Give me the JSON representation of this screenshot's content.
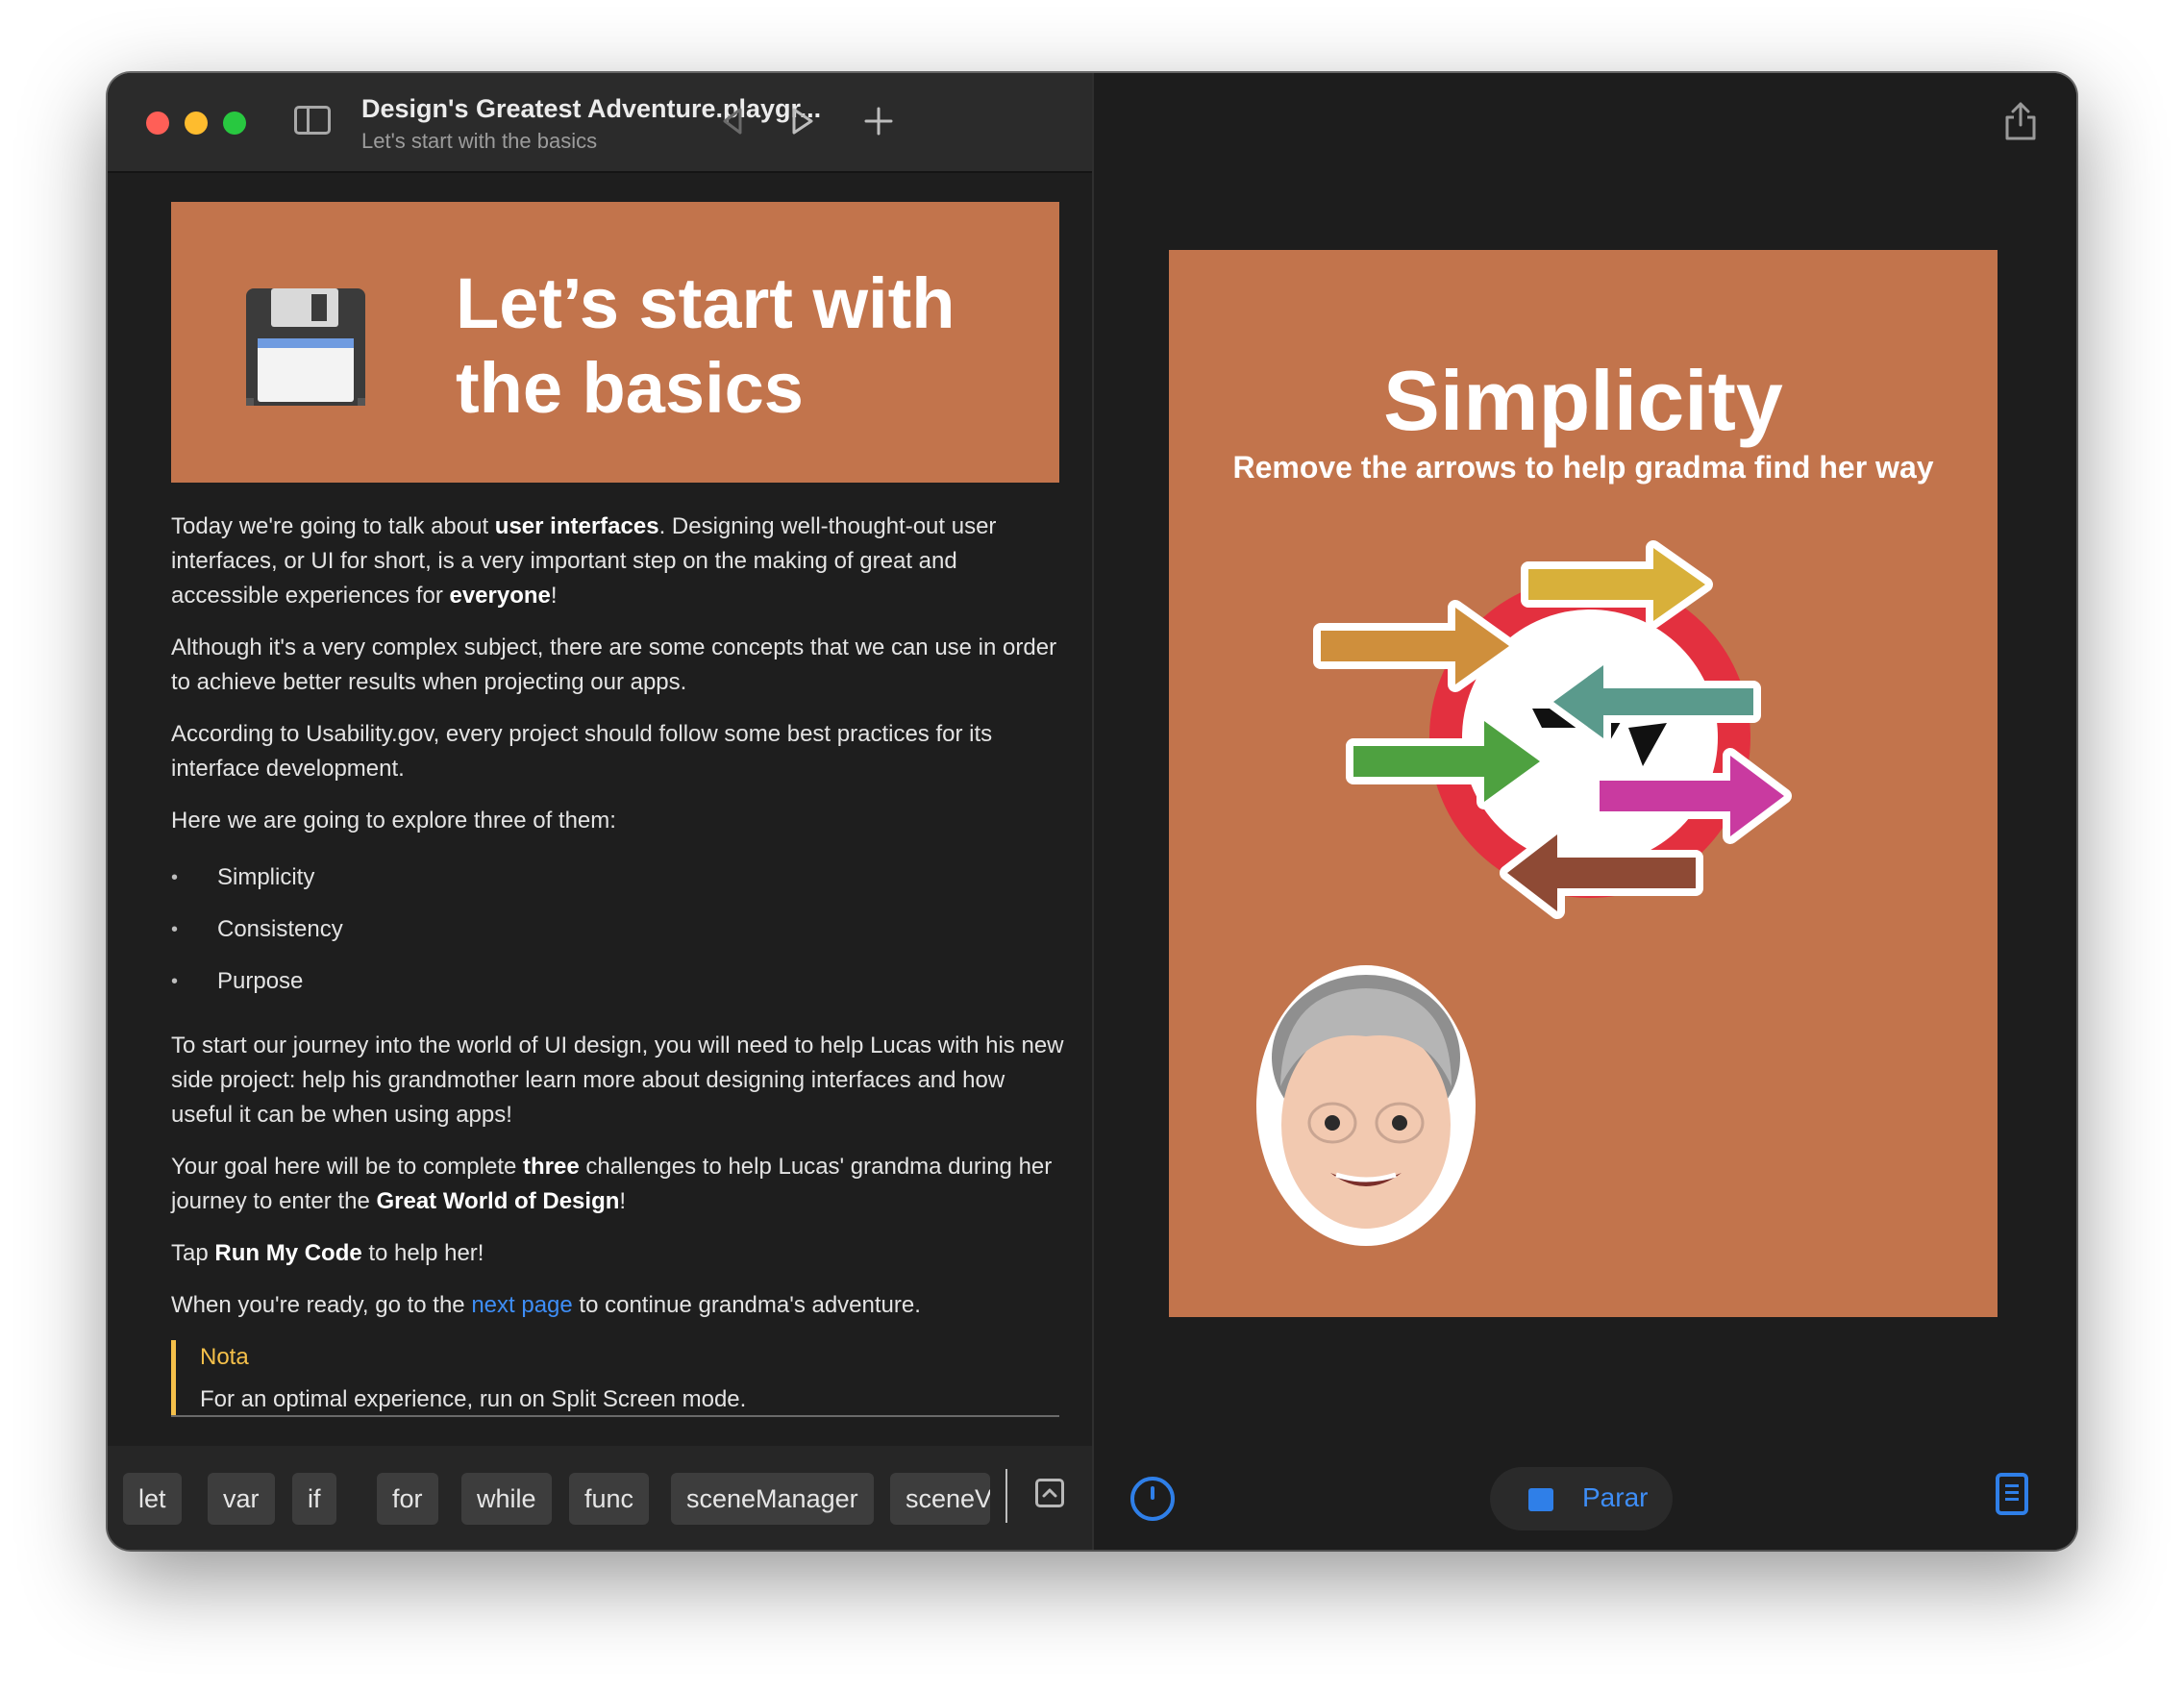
{
  "window": {
    "title": "Design's Greatest Adventure.playgr...",
    "subtitle": "Let's start with the basics"
  },
  "banner": {
    "icon": "floppy-disk-icon",
    "title": "Let’s start with the basics"
  },
  "content": {
    "p1_a": "Today we're going to talk about ",
    "p1_b": "user interfaces",
    "p1_c": ". Designing well-thought-out user interfaces, or UI for short, is a very important step on the making of great and accessible experiences for ",
    "p1_d": "everyone",
    "p1_e": "!",
    "p2": "Although it's a very complex subject, there are some concepts that we can use in order to achieve better results when projecting our apps.",
    "p3": "According to Usability.gov, every project should follow some best practices for its interface development.",
    "p4": "Here we are going to explore three of them:",
    "list": [
      "Simplicity",
      "Consistency",
      "Purpose"
    ],
    "p5": "To start our journey into the world of UI design, you will need to help Lucas with his new side project: help his grandmother learn more about designing interfaces and how useful it can be when using apps!",
    "p6_a": "Your goal here will be to complete ",
    "p6_b": "three",
    "p6_c": " challenges to help Lucas' grandma during her journey to enter the ",
    "p6_d": "Great World of Design",
    "p6_e": "!",
    "p7_a": "Tap ",
    "p7_b": "Run My Code",
    "p7_c": " to help her!",
    "p8_a": "When you're ready, go to the ",
    "p8_link": "next page",
    "p8_c": " to continue grandma's adventure.",
    "note_title": "Nota",
    "note_body": "For an optimal experience, run on Split Screen mode."
  },
  "keywords": [
    "let",
    "var",
    "if",
    "for",
    "while",
    "func",
    "sceneManager",
    "sceneV"
  ],
  "stage": {
    "title": "Simplicity",
    "subtitle": "Remove the arrows to help gradma find her way"
  },
  "controls": {
    "stop_label": "Parar"
  },
  "colors": {
    "banner_bg": "#c2744c",
    "accent_blue": "#2f7fe8",
    "note_yellow": "#f5c04a"
  }
}
